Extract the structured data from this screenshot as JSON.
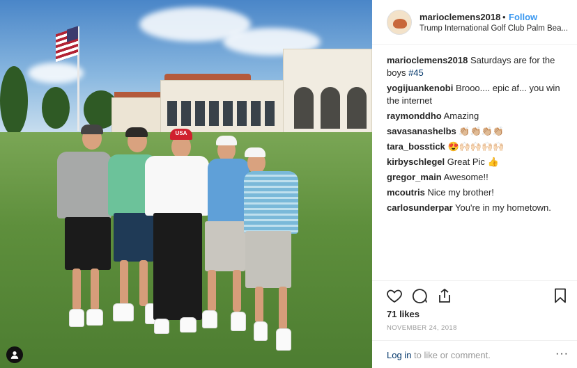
{
  "post": {
    "username": "marioclemens2018",
    "separator": "•",
    "follow_label": "Follow",
    "location": "Trump International Golf Club Palm Bea..."
  },
  "comments": [
    {
      "user": "marioclemens2018",
      "text": "Saturdays are for the boys ",
      "hashtag": "#45"
    },
    {
      "user": "yogijuankenobi",
      "text": "Brooo.... epic af... you win the internet"
    },
    {
      "user": "raymonddho",
      "text": "Amazing"
    },
    {
      "user": "savasanashelbs",
      "text": "👏🏼👏🏼👏🏼👏🏼"
    },
    {
      "user": "tara_bosstick",
      "text": "😍🙌🏻🙌🏻🙌🏻🙌🏻"
    },
    {
      "user": "kirbyschlegel",
      "text": "Great Pic 👍"
    },
    {
      "user": "gregor_main",
      "text": "Awesome!!"
    },
    {
      "user": "mcoutris",
      "text": "Nice my brother!"
    },
    {
      "user": "carlosunderpar",
      "text": "You're in my hometown."
    }
  ],
  "actions": {
    "like_icon": "heart-icon",
    "comment_icon": "comment-icon",
    "share_icon": "share-icon",
    "save_icon": "bookmark-icon"
  },
  "likes": "71 likes",
  "date": "NOVEMBER 24, 2018",
  "footer": {
    "login_label": "Log in",
    "login_suffix": " to like or comment.",
    "more_label": "···"
  },
  "colors": {
    "follow": "#3897f0",
    "link": "#003569",
    "muted": "#999999"
  },
  "photo": {
    "cap_text": "USA"
  }
}
